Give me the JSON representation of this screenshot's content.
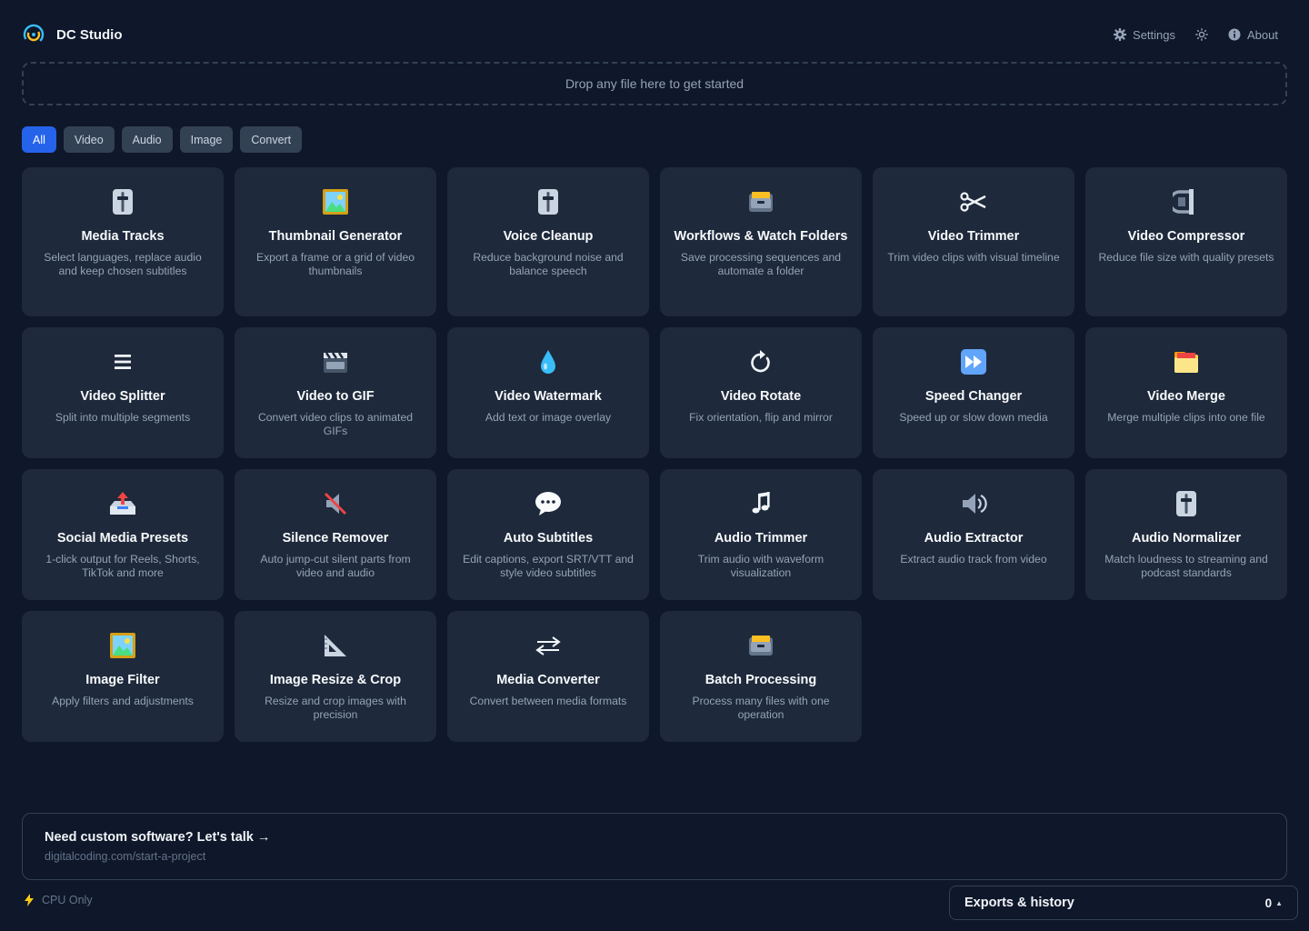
{
  "app": {
    "name": "DC Studio",
    "logo_icon": "dc-studio-logo"
  },
  "header": {
    "settings_label": "Settings",
    "settings_icon": "gear-icon",
    "theme_icon": "sun-icon",
    "about_label": "About",
    "about_icon": "info-icon"
  },
  "dropzone": {
    "text": "Drop any file here to get started"
  },
  "filters": {
    "active": "All",
    "items": [
      "All",
      "Video",
      "Audio",
      "Image",
      "Convert"
    ]
  },
  "tools": [
    {
      "title": "Media Tracks",
      "desc": "Select languages, replace audio and keep chosen subtitles",
      "icon": "sliders-icon"
    },
    {
      "title": "Thumbnail Generator",
      "desc": "Export a frame or a grid of video thumbnails",
      "icon": "framed-picture-icon"
    },
    {
      "title": "Voice Cleanup",
      "desc": "Reduce background noise and balance speech",
      "icon": "sliders-icon"
    },
    {
      "title": "Workflows & Watch Folders",
      "desc": "Save processing sequences and automate a folder",
      "icon": "card-box-icon"
    },
    {
      "title": "Video Trimmer",
      "desc": "Trim video clips with visual timeline",
      "icon": "scissors-icon"
    },
    {
      "title": "Video Compressor",
      "desc": "Reduce file size with quality presets",
      "icon": "clamp-icon"
    },
    {
      "title": "Video Splitter",
      "desc": "Split into multiple segments",
      "icon": "menu-lines-icon"
    },
    {
      "title": "Video to GIF",
      "desc": "Convert video clips to animated GIFs",
      "icon": "clapper-icon"
    },
    {
      "title": "Video Watermark",
      "desc": "Add text or image overlay",
      "icon": "droplet-icon"
    },
    {
      "title": "Video Rotate",
      "desc": "Fix orientation, flip and mirror",
      "icon": "rotate-icon"
    },
    {
      "title": "Speed Changer",
      "desc": "Speed up or slow down media",
      "icon": "fast-forward-icon"
    },
    {
      "title": "Video Merge",
      "desc": "Merge multiple clips into one file",
      "icon": "folder-box-icon"
    },
    {
      "title": "Social Media Presets",
      "desc": "1-click output for Reels, Shorts, TikTok and more",
      "icon": "outbox-tray-icon"
    },
    {
      "title": "Silence Remover",
      "desc": "Auto jump-cut silent parts from video and audio",
      "icon": "muted-speaker-icon"
    },
    {
      "title": "Auto Subtitles",
      "desc": "Edit captions, export SRT/VTT and style video subtitles",
      "icon": "speech-bubble-icon"
    },
    {
      "title": "Audio Trimmer",
      "desc": "Trim audio with waveform visualization",
      "icon": "music-note-icon"
    },
    {
      "title": "Audio Extractor",
      "desc": "Extract audio track from video",
      "icon": "speaker-icon"
    },
    {
      "title": "Audio Normalizer",
      "desc": "Match loudness to streaming and podcast standards",
      "icon": "sliders-icon"
    },
    {
      "title": "Image Filter",
      "desc": "Apply filters and adjustments",
      "icon": "framed-picture-icon"
    },
    {
      "title": "Image Resize & Crop",
      "desc": "Resize and crop images with precision",
      "icon": "triangle-ruler-icon"
    },
    {
      "title": "Media Converter",
      "desc": "Convert between media formats",
      "icon": "swap-arrows-icon"
    },
    {
      "title": "Batch Processing",
      "desc": "Process many files with one operation",
      "icon": "card-box-icon"
    }
  ],
  "promo": {
    "title": "Need custom software? Let's talk →",
    "link": "digitalcoding.com/start-a-project"
  },
  "status": {
    "cpu_label": "CPU Only",
    "cpu_icon": "lightning-icon"
  },
  "exports": {
    "label": "Exports & history",
    "count": "0",
    "caret": "▲"
  },
  "colors": {
    "background": "#0f172a",
    "card": "#1e293b",
    "accent": "#2563eb",
    "muted_text": "#94a3b8"
  }
}
